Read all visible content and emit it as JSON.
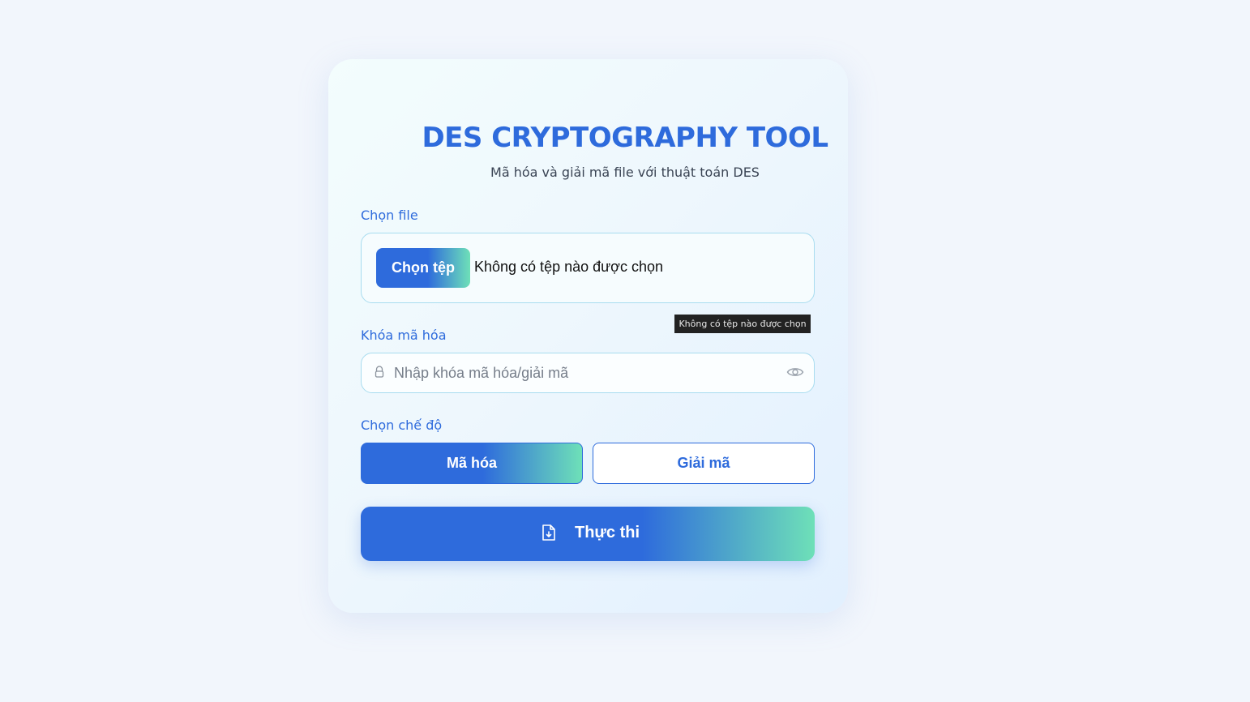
{
  "header": {
    "title": "DES CRYPTOGRAPHY TOOL",
    "subtitle": "Mã hóa và giải mã file với thuật toán DES"
  },
  "file": {
    "label": "Chọn file",
    "button_label": "Chọn tệp",
    "status": "Không có tệp nào được chọn",
    "tooltip": "Không có tệp nào được chọn"
  },
  "key": {
    "label": "Khóa mã hóa",
    "placeholder": "Nhập khóa mã hóa/giải mã",
    "value": "",
    "lock_icon": "lock-icon",
    "toggle_icon": "eye-icon"
  },
  "mode": {
    "label": "Chọn chế độ",
    "encrypt_label": "Mã hóa",
    "decrypt_label": "Giải mã",
    "selected": "Mã hóa"
  },
  "action": {
    "run_label": "Thực thi",
    "icon": "file-download-icon"
  },
  "colors": {
    "accent": "#2e6bdc",
    "gradient_end": "#6ee0b8",
    "border": "#a8dcef",
    "background": "#f2f6fc"
  }
}
